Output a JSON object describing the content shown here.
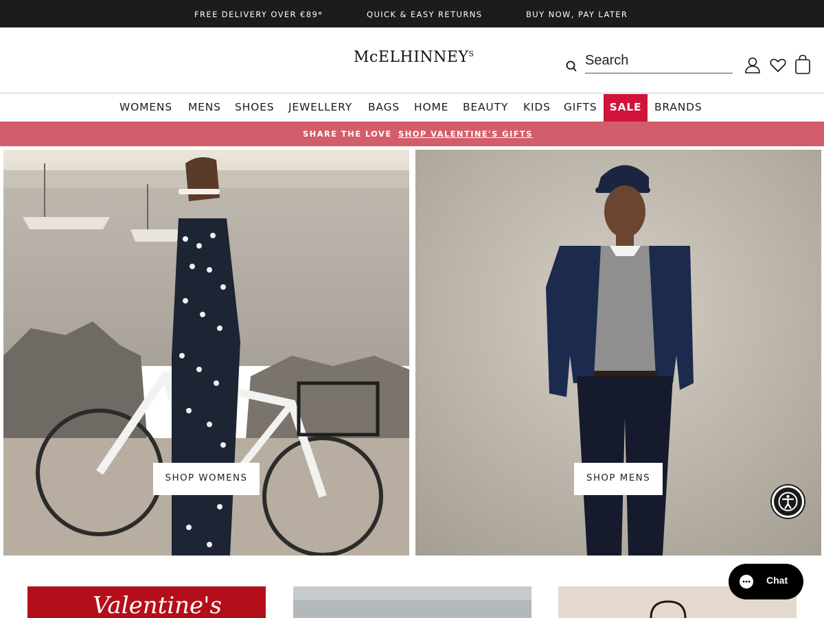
{
  "topbar": {
    "items": [
      "FREE DELIVERY OVER €89*",
      "QUICK & EASY RETURNS",
      "BUY NOW, PAY LATER"
    ]
  },
  "header": {
    "logo": {
      "main": "McELHINNEY",
      "super": "S"
    },
    "search": {
      "placeholder": "Search",
      "value": ""
    },
    "icons": [
      "account-icon",
      "wishlist-icon",
      "bag-icon"
    ]
  },
  "nav": {
    "items": [
      "WOMENS",
      "MENS",
      "SHOES",
      "JEWELLERY",
      "BAGS",
      "HOME",
      "BEAUTY",
      "KIDS",
      "GIFTS",
      "SALE",
      "BRANDS"
    ]
  },
  "promo": {
    "text": "SHARE THE LOVE",
    "link": "SHOP VALENTINE'S GIFTS"
  },
  "hero": {
    "women_cta": "SHOP WOMENS",
    "men_cta": "SHOP MENS"
  },
  "tiles": {
    "valentines_text": "Valentine's"
  },
  "chat": {
    "label": "Chat"
  },
  "colors": {
    "topbar": "#1c1c1c",
    "sale": "#d0143a",
    "promo": "#d45d6b",
    "chat": "#000000"
  }
}
